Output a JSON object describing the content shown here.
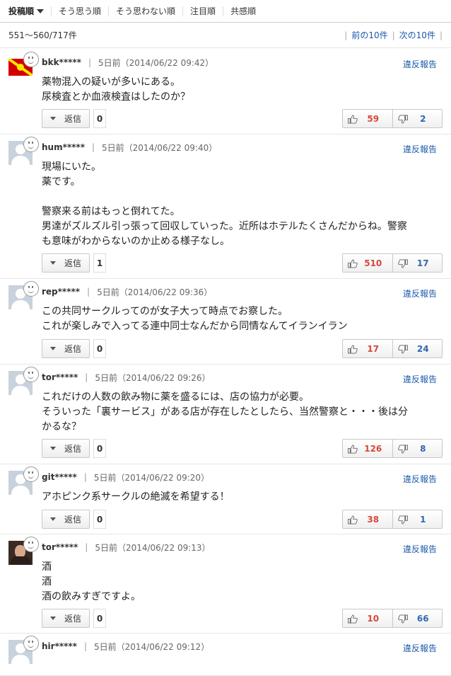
{
  "sortbar": {
    "items": [
      "投稿順",
      "そう思う順",
      "そう思わない順",
      "注目順",
      "共感順"
    ]
  },
  "pager": {
    "count": "551〜560/717件",
    "prev": "前の10件",
    "next": "次の10件"
  },
  "report_label": "違反報告",
  "reply_label": "返信",
  "comments": [
    {
      "user": "bkk*****",
      "time": "5日前（2014/06/22 09:42）",
      "avatar": "flag",
      "lines": [
        "薬物混入の疑いが多いにある。",
        "尿検査とか血液検査はしたのか？"
      ],
      "replies": "0",
      "likes": "59",
      "dislikes": "2"
    },
    {
      "user": "hum*****",
      "time": "5日前（2014/06/22 09:40）",
      "avatar": "silhouette",
      "lines": [
        "現場にいた。",
        "薬です。",
        "",
        "警察来る前はもっと倒れてた。",
        "男達がズルズル引っ張って回収していった。近所はホテルたくさんだからね。警察",
        "も意味がわからないのか止める様子なし。"
      ],
      "replies": "1",
      "likes": "510",
      "dislikes": "17"
    },
    {
      "user": "rep*****",
      "time": "5日前（2014/06/22 09:36）",
      "avatar": "silhouette",
      "lines": [
        "この共同サークルってのが女子大って時点でお察した。",
        "これが楽しみで入ってる連中同士なんだから同情なんてイランイラン"
      ],
      "replies": "0",
      "likes": "17",
      "dislikes": "24"
    },
    {
      "user": "tor*****",
      "time": "5日前（2014/06/22 09:26）",
      "avatar": "silhouette",
      "lines": [
        "これだけの人数の飲み物に薬を盛るには、店の協力が必要。",
        "そういった「裏サービス」がある店が存在したとしたら、当然警察と・・・後は分",
        "かるな？"
      ],
      "replies": "0",
      "likes": "126",
      "dislikes": "8"
    },
    {
      "user": "git*****",
      "time": "5日前（2014/06/22 09:20）",
      "avatar": "silhouette",
      "lines": [
        "アホピンク系サークルの絶滅を希望する！"
      ],
      "replies": "0",
      "likes": "38",
      "dislikes": "1"
    },
    {
      "user": "tor*****",
      "time": "5日前（2014/06/22 09:13）",
      "avatar": "photo",
      "lines": [
        "酒",
        "酒",
        "酒の飲みすぎですよ。"
      ],
      "replies": "0",
      "likes": "10",
      "dislikes": "66"
    },
    {
      "user": "hir*****",
      "time": "5日前（2014/06/22 09:12）",
      "avatar": "silhouette",
      "lines": [],
      "replies": "",
      "likes": "",
      "dislikes": ""
    }
  ]
}
